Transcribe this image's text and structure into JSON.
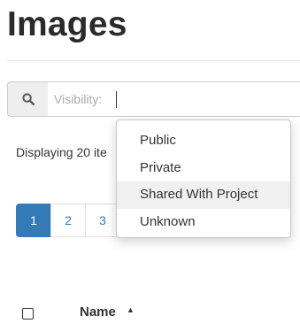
{
  "page": {
    "title": "Images"
  },
  "search": {
    "icon": "search-icon",
    "facet_label": "Visibility:",
    "value": ""
  },
  "summary": {
    "text": "Displaying 20 ite"
  },
  "pagination": {
    "pages": [
      "1",
      "2",
      "3"
    ],
    "active": "1"
  },
  "dropdown": {
    "options": [
      "Public",
      "Private",
      "Shared With Project",
      "Unknown"
    ],
    "highlighted": "Shared With Project"
  },
  "table": {
    "columns": [
      {
        "label": "Name",
        "sort": "ascending",
        "icon": "sort-ascending-icon"
      }
    ]
  },
  "colors": {
    "accent": "#337ab7",
    "title": "#2b2b2b",
    "addon_bg": "#eeeeee",
    "highlight_bg": "#f0f0f0"
  }
}
